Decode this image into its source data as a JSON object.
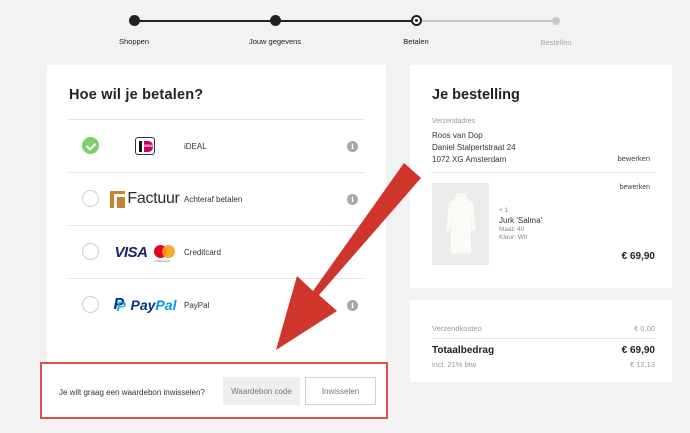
{
  "steps": [
    {
      "label": "Shoppen",
      "state": "done"
    },
    {
      "label": "Jouw gegevens",
      "state": "done"
    },
    {
      "label": "Betalen",
      "state": "current"
    },
    {
      "label": "Bestellen",
      "state": "todo"
    }
  ],
  "payment": {
    "title": "Hoe wil je betalen?",
    "methods": [
      {
        "name": "iDEAL",
        "logo_text": "iDEAL",
        "selected": true,
        "info_icon": "info-icon"
      },
      {
        "name": "Achteraf betalen",
        "logo_text": "Factuur",
        "selected": false,
        "info_icon": "info-icon"
      },
      {
        "name": "Creditcard",
        "logo_text": "VISA",
        "logo_text_2": "mastercard",
        "selected": false,
        "info_icon": null
      },
      {
        "name": "PayPal",
        "logo_text": "Pay",
        "logo_text_2": "Pal",
        "selected": false,
        "info_icon": "info-icon"
      }
    ],
    "info_glyph": "i"
  },
  "voucher": {
    "label": "Je wilt graag een waardebon inwisselen?",
    "placeholder": "Waardebon code",
    "button": "Inwisselen"
  },
  "order": {
    "title": "Je bestelling",
    "address_label": "Verzendadres",
    "address_lines": [
      "Roos van Dop",
      "Daniel Stalpertstraat 24",
      "1072 XG Amsterdam"
    ],
    "edit_address": "bewerken",
    "edit_item": "bewerken",
    "item": {
      "qty": "+ 1",
      "name": "Jurk 'Salma'",
      "size": "Maat: 40",
      "color": "Kleur: Wit",
      "price": "€ 69,90"
    }
  },
  "totals": {
    "shipping_label": "Verzendkosten",
    "shipping_value": "€ 0,00",
    "total_label": "Totaalbedrag",
    "total_value": "€ 69,90",
    "vat_label": "incl. 21% btw",
    "vat_value": "€ 12,13"
  },
  "colors": {
    "accent_green": "#7bd06d",
    "annotation_red": "#d0352b",
    "progress_dark": "#222222",
    "progress_todo": "#c8c8c8"
  }
}
